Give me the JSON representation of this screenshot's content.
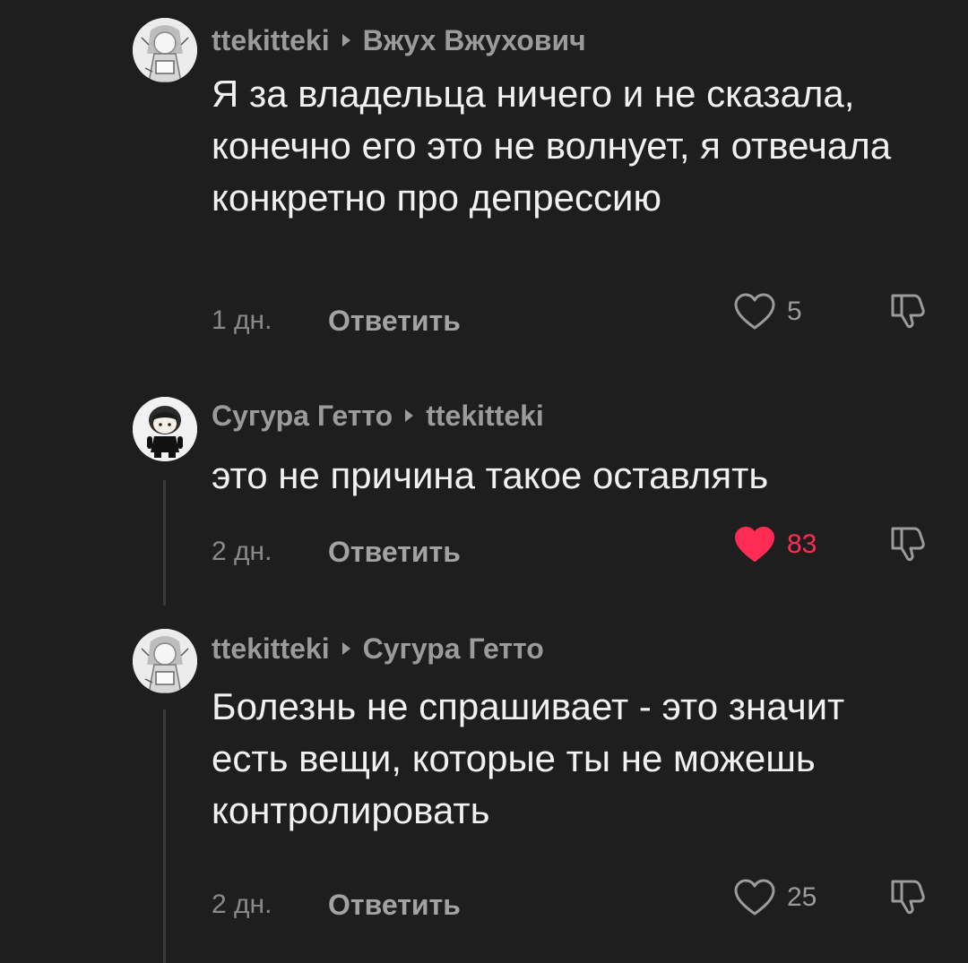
{
  "comments": [
    {
      "author": "ttekitteki",
      "reply_to": "Вжух Вжухович",
      "text": "Я за владельца ничего и не сказала, конечно его это не волнует, я отвечала конкретно про депрессию",
      "time": "1 дн.",
      "reply_label": "Ответить",
      "likes": "5",
      "liked": false,
      "avatar_icon": "manga-girl-avatar"
    },
    {
      "author": "Сугура Гетто",
      "reply_to": "ttekitteki",
      "text": "это не причина такое оставлять",
      "time": "2 дн.",
      "reply_label": "Ответить",
      "likes": "83",
      "liked": true,
      "avatar_icon": "chibi-character-avatar"
    },
    {
      "author": "ttekitteki",
      "reply_to": "Сугура Гетто",
      "text": "Болезнь не спрашивает - это значит есть вещи, которые ты не можешь контролировать",
      "time": "2 дн.",
      "reply_label": "Ответить",
      "likes": "25",
      "liked": false,
      "avatar_icon": "manga-girl-avatar"
    }
  ],
  "colors": {
    "background": "#1e1e1e",
    "text": "#f1f1f1",
    "muted": "#9b9b9b",
    "like_active": "#fe2c55"
  }
}
